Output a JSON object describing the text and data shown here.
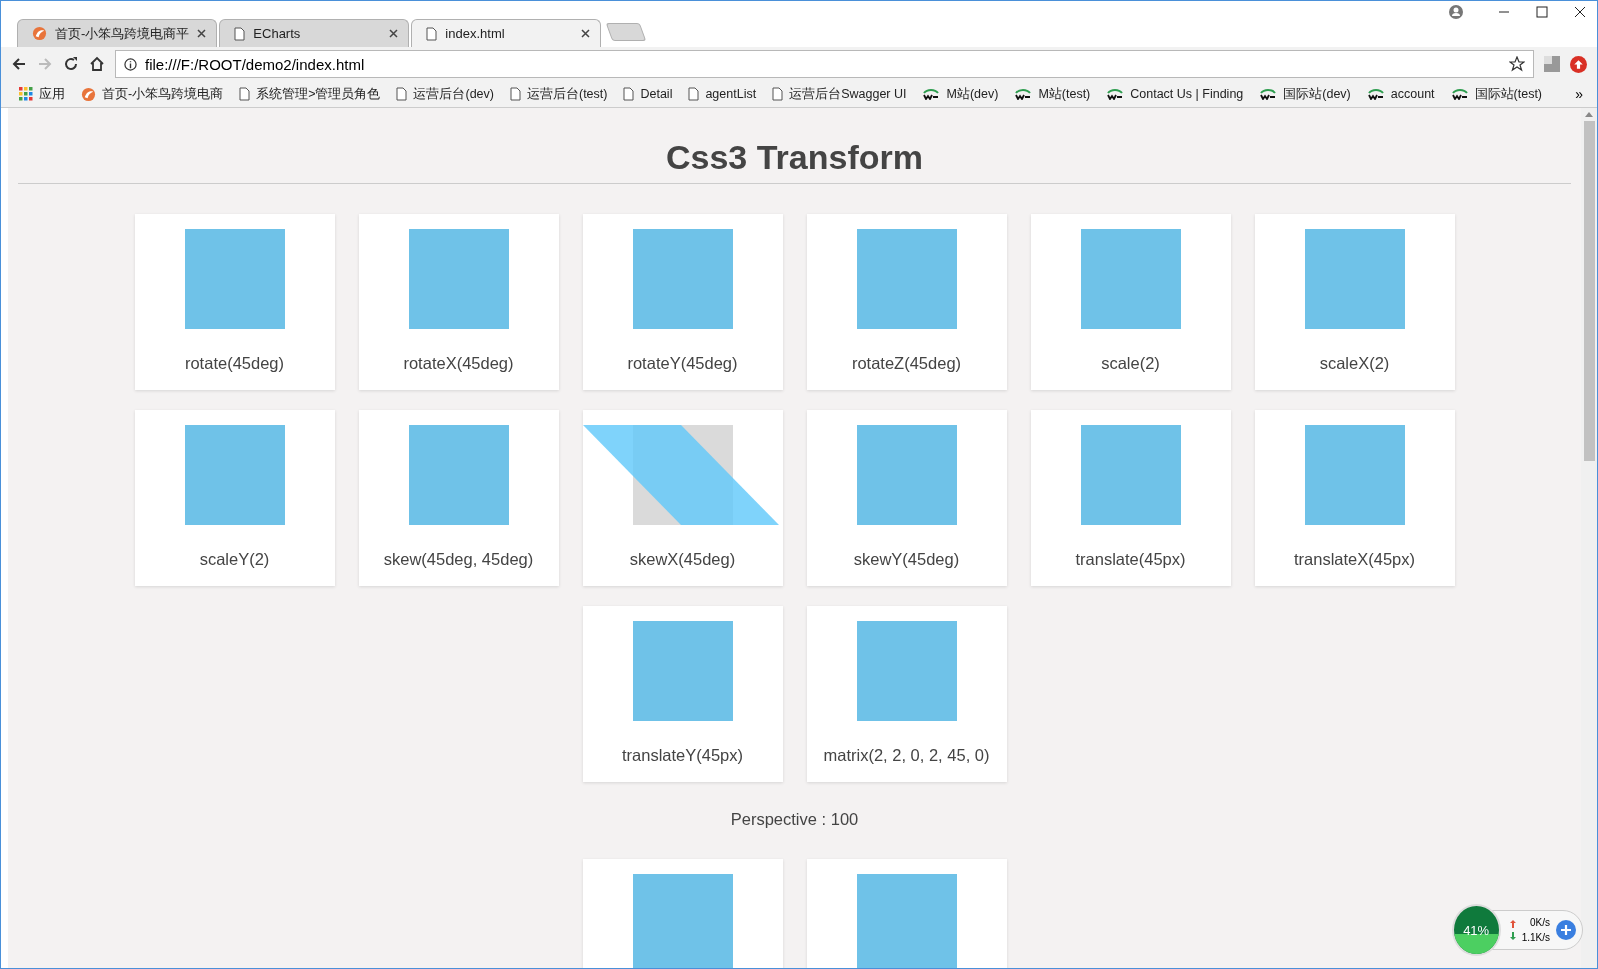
{
  "tabs": [
    {
      "title": "首页-小笨鸟跨境电商平",
      "kind": "bird",
      "selected": false
    },
    {
      "title": "ECharts",
      "kind": "page",
      "selected": false
    },
    {
      "title": "index.html",
      "kind": "page",
      "selected": true
    }
  ],
  "address": {
    "url": "file:///F:/ROOT/demo2/index.html"
  },
  "bookmarks": [
    {
      "label": "应用",
      "kind": "apps"
    },
    {
      "label": "首页-小笨鸟跨境电商",
      "kind": "bird"
    },
    {
      "label": "系统管理>管理员角色",
      "kind": "page"
    },
    {
      "label": "运营后台(dev)",
      "kind": "page"
    },
    {
      "label": "运营后台(test)",
      "kind": "page"
    },
    {
      "label": "Detail",
      "kind": "page"
    },
    {
      "label": "agentList",
      "kind": "page"
    },
    {
      "label": "运营后台Swagger UI",
      "kind": "page"
    },
    {
      "label": "M站(dev)",
      "kind": "we"
    },
    {
      "label": "M站(test)",
      "kind": "we"
    },
    {
      "label": "Contact Us | Finding",
      "kind": "we"
    },
    {
      "label": "国际站(dev)",
      "kind": "we"
    },
    {
      "label": "account",
      "kind": "we"
    },
    {
      "label": "国际站(test)",
      "kind": "we"
    }
  ],
  "bookmarks_more": "»",
  "page": {
    "title": "Css3 Transform",
    "cards": [
      {
        "label": "rotate(45deg)",
        "kind": "plain"
      },
      {
        "label": "rotateX(45deg)",
        "kind": "plain"
      },
      {
        "label": "rotateY(45deg)",
        "kind": "plain"
      },
      {
        "label": "rotateZ(45deg)",
        "kind": "plain"
      },
      {
        "label": "scale(2)",
        "kind": "plain"
      },
      {
        "label": "scaleX(2)",
        "kind": "plain"
      },
      {
        "label": "scaleY(2)",
        "kind": "plain"
      },
      {
        "label": "skew(45deg, 45deg)",
        "kind": "plain"
      },
      {
        "label": "skewX(45deg)",
        "kind": "skewed"
      },
      {
        "label": "skewY(45deg)",
        "kind": "plain"
      },
      {
        "label": "translate(45px)",
        "kind": "plain"
      },
      {
        "label": "translateX(45px)",
        "kind": "plain"
      },
      {
        "label": "translateY(45px)",
        "kind": "plain"
      },
      {
        "label": "matrix(2, 2, 0, 2, 45, 0)",
        "kind": "plain"
      }
    ],
    "perspective_label": "Perspective : 100",
    "perspective_cards": [
      {
        "kind": "plain"
      },
      {
        "kind": "plain"
      }
    ]
  },
  "speed_widget": {
    "memory": "41%",
    "level": 0.41,
    "upload": "0K/s",
    "download": "1.1K/s"
  }
}
